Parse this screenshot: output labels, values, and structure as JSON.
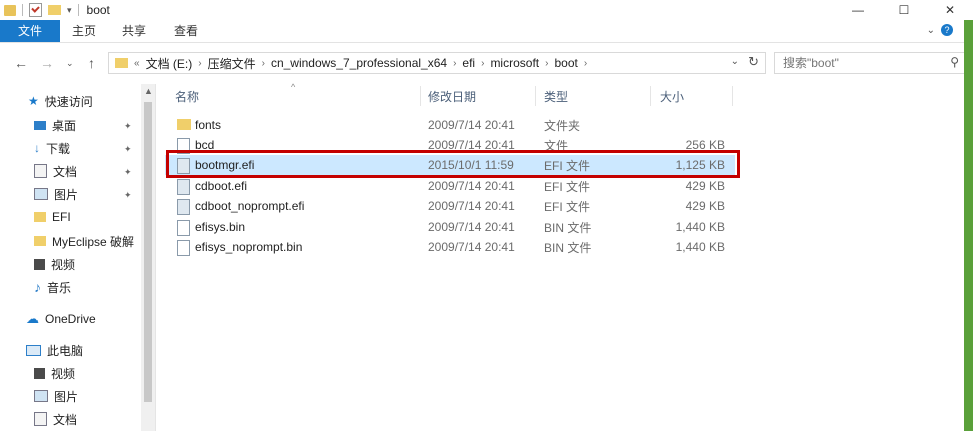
{
  "window": {
    "title": "boot",
    "controls": [
      "—",
      "☐",
      "✕"
    ]
  },
  "ribbon": {
    "tabs": [
      "文件",
      "主页",
      "共享",
      "查看"
    ],
    "help": "?"
  },
  "address": {
    "prefix": "«",
    "segments": [
      "文档 (E:)",
      "压缩文件",
      "cn_windows_7_professional_x64",
      "efi",
      "microsoft",
      "boot"
    ]
  },
  "search": {
    "placeholder": "搜索\"boot\""
  },
  "nav": {
    "items": [
      {
        "label": "快速访问",
        "icon": "star-icon"
      },
      {
        "label": "桌面",
        "icon": "desktop-icon",
        "pinned": true
      },
      {
        "label": "下载",
        "icon": "download-icon",
        "pinned": true
      },
      {
        "label": "文档",
        "icon": "document-icon",
        "pinned": true
      },
      {
        "label": "图片",
        "icon": "picture-icon",
        "pinned": true
      },
      {
        "label": "EFI",
        "icon": "folder-icon"
      },
      {
        "label": "MyEclipse 破解",
        "icon": "folder-icon"
      },
      {
        "label": "视频",
        "icon": "video-icon"
      },
      {
        "label": "音乐",
        "icon": "music-icon"
      },
      {
        "label": "OneDrive",
        "icon": "cloud-icon"
      },
      {
        "label": "此电脑",
        "icon": "computer-icon"
      },
      {
        "label": "视频",
        "icon": "video-icon"
      },
      {
        "label": "图片",
        "icon": "picture-icon"
      },
      {
        "label": "文档",
        "icon": "document-icon"
      }
    ]
  },
  "columns": {
    "name": "名称",
    "date": "修改日期",
    "type": "类型",
    "size": "大小"
  },
  "files": [
    {
      "name": "fonts",
      "date": "2009/7/14 20:41",
      "type": "文件夹",
      "size": "",
      "icon": "folder-icon"
    },
    {
      "name": "bcd",
      "date": "2009/7/14 20:41",
      "type": "文件",
      "size": "256 KB",
      "icon": "file-icon"
    },
    {
      "name": "bootmgr.efi",
      "date": "2015/10/1 11:59",
      "type": "EFI 文件",
      "size": "1,125 KB",
      "icon": "efi-file-icon",
      "selected": true
    },
    {
      "name": "cdboot.efi",
      "date": "2009/7/14 20:41",
      "type": "EFI 文件",
      "size": "429 KB",
      "icon": "efi-file-icon"
    },
    {
      "name": "cdboot_noprompt.efi",
      "date": "2009/7/14 20:41",
      "type": "EFI 文件",
      "size": "429 KB",
      "icon": "efi-file-icon"
    },
    {
      "name": "efisys.bin",
      "date": "2009/7/14 20:41",
      "type": "BIN 文件",
      "size": "1,440 KB",
      "icon": "file-icon"
    },
    {
      "name": "efisys_noprompt.bin",
      "date": "2009/7/14 20:41",
      "type": "BIN 文件",
      "size": "1,440 KB",
      "icon": "file-icon"
    }
  ],
  "colors": {
    "accent": "#1979ca",
    "selection": "#cce8ff",
    "highlight_box": "#c40000"
  }
}
